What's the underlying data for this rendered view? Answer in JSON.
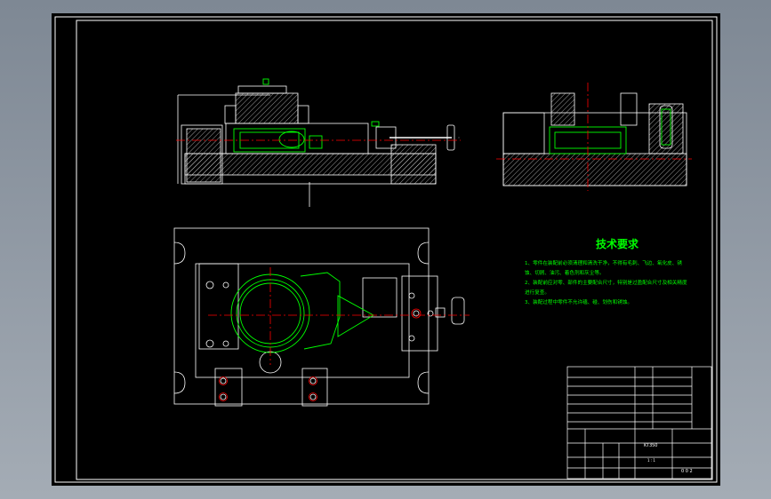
{
  "technical_requirements": {
    "title": "技术要求",
    "items": [
      "1、零件在装配前必须清理和清洗干净，不得有毛刺、飞边、氧化皮、锈",
      "蚀、切屑、油污、着色剂和灰尘等。",
      "2、装配前应对零、部件的主要配合尺寸，特别是过盈配合尺寸及相关精度",
      "进行复查。",
      "3、装配过程中零件不允许磕、碰、划伤和锈蚀。"
    ]
  },
  "title_block": {
    "material": "KT350",
    "drawing_no": "1 : 1",
    "sheet": "0 0 2"
  },
  "colors": {
    "background": "#000000",
    "frame": "#ffffff",
    "part_outline": "#ffffff",
    "workpiece": "#00ff00",
    "centerline": "#ff0000",
    "hatch": "#ffffff"
  }
}
